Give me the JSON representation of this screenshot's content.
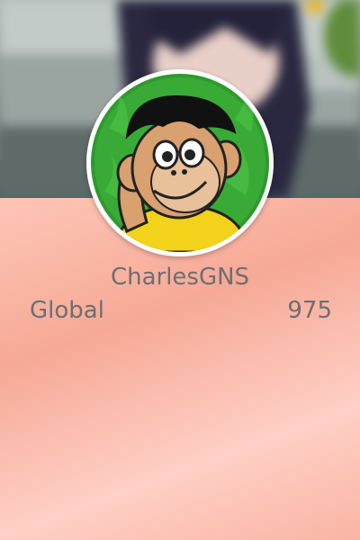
{
  "profile": {
    "username": "CharlesGNS",
    "avatar_icon": "cartoon-monkey-avatar",
    "banner_image": "blurred-anime-character-banner"
  },
  "stats": {
    "scope_label": "Global",
    "value": "975"
  },
  "colors": {
    "text": "#6e6e70",
    "avatar_background": "#2e9a2e",
    "avatar_border": "#ffffff",
    "card_background": "#fcc0b0"
  }
}
